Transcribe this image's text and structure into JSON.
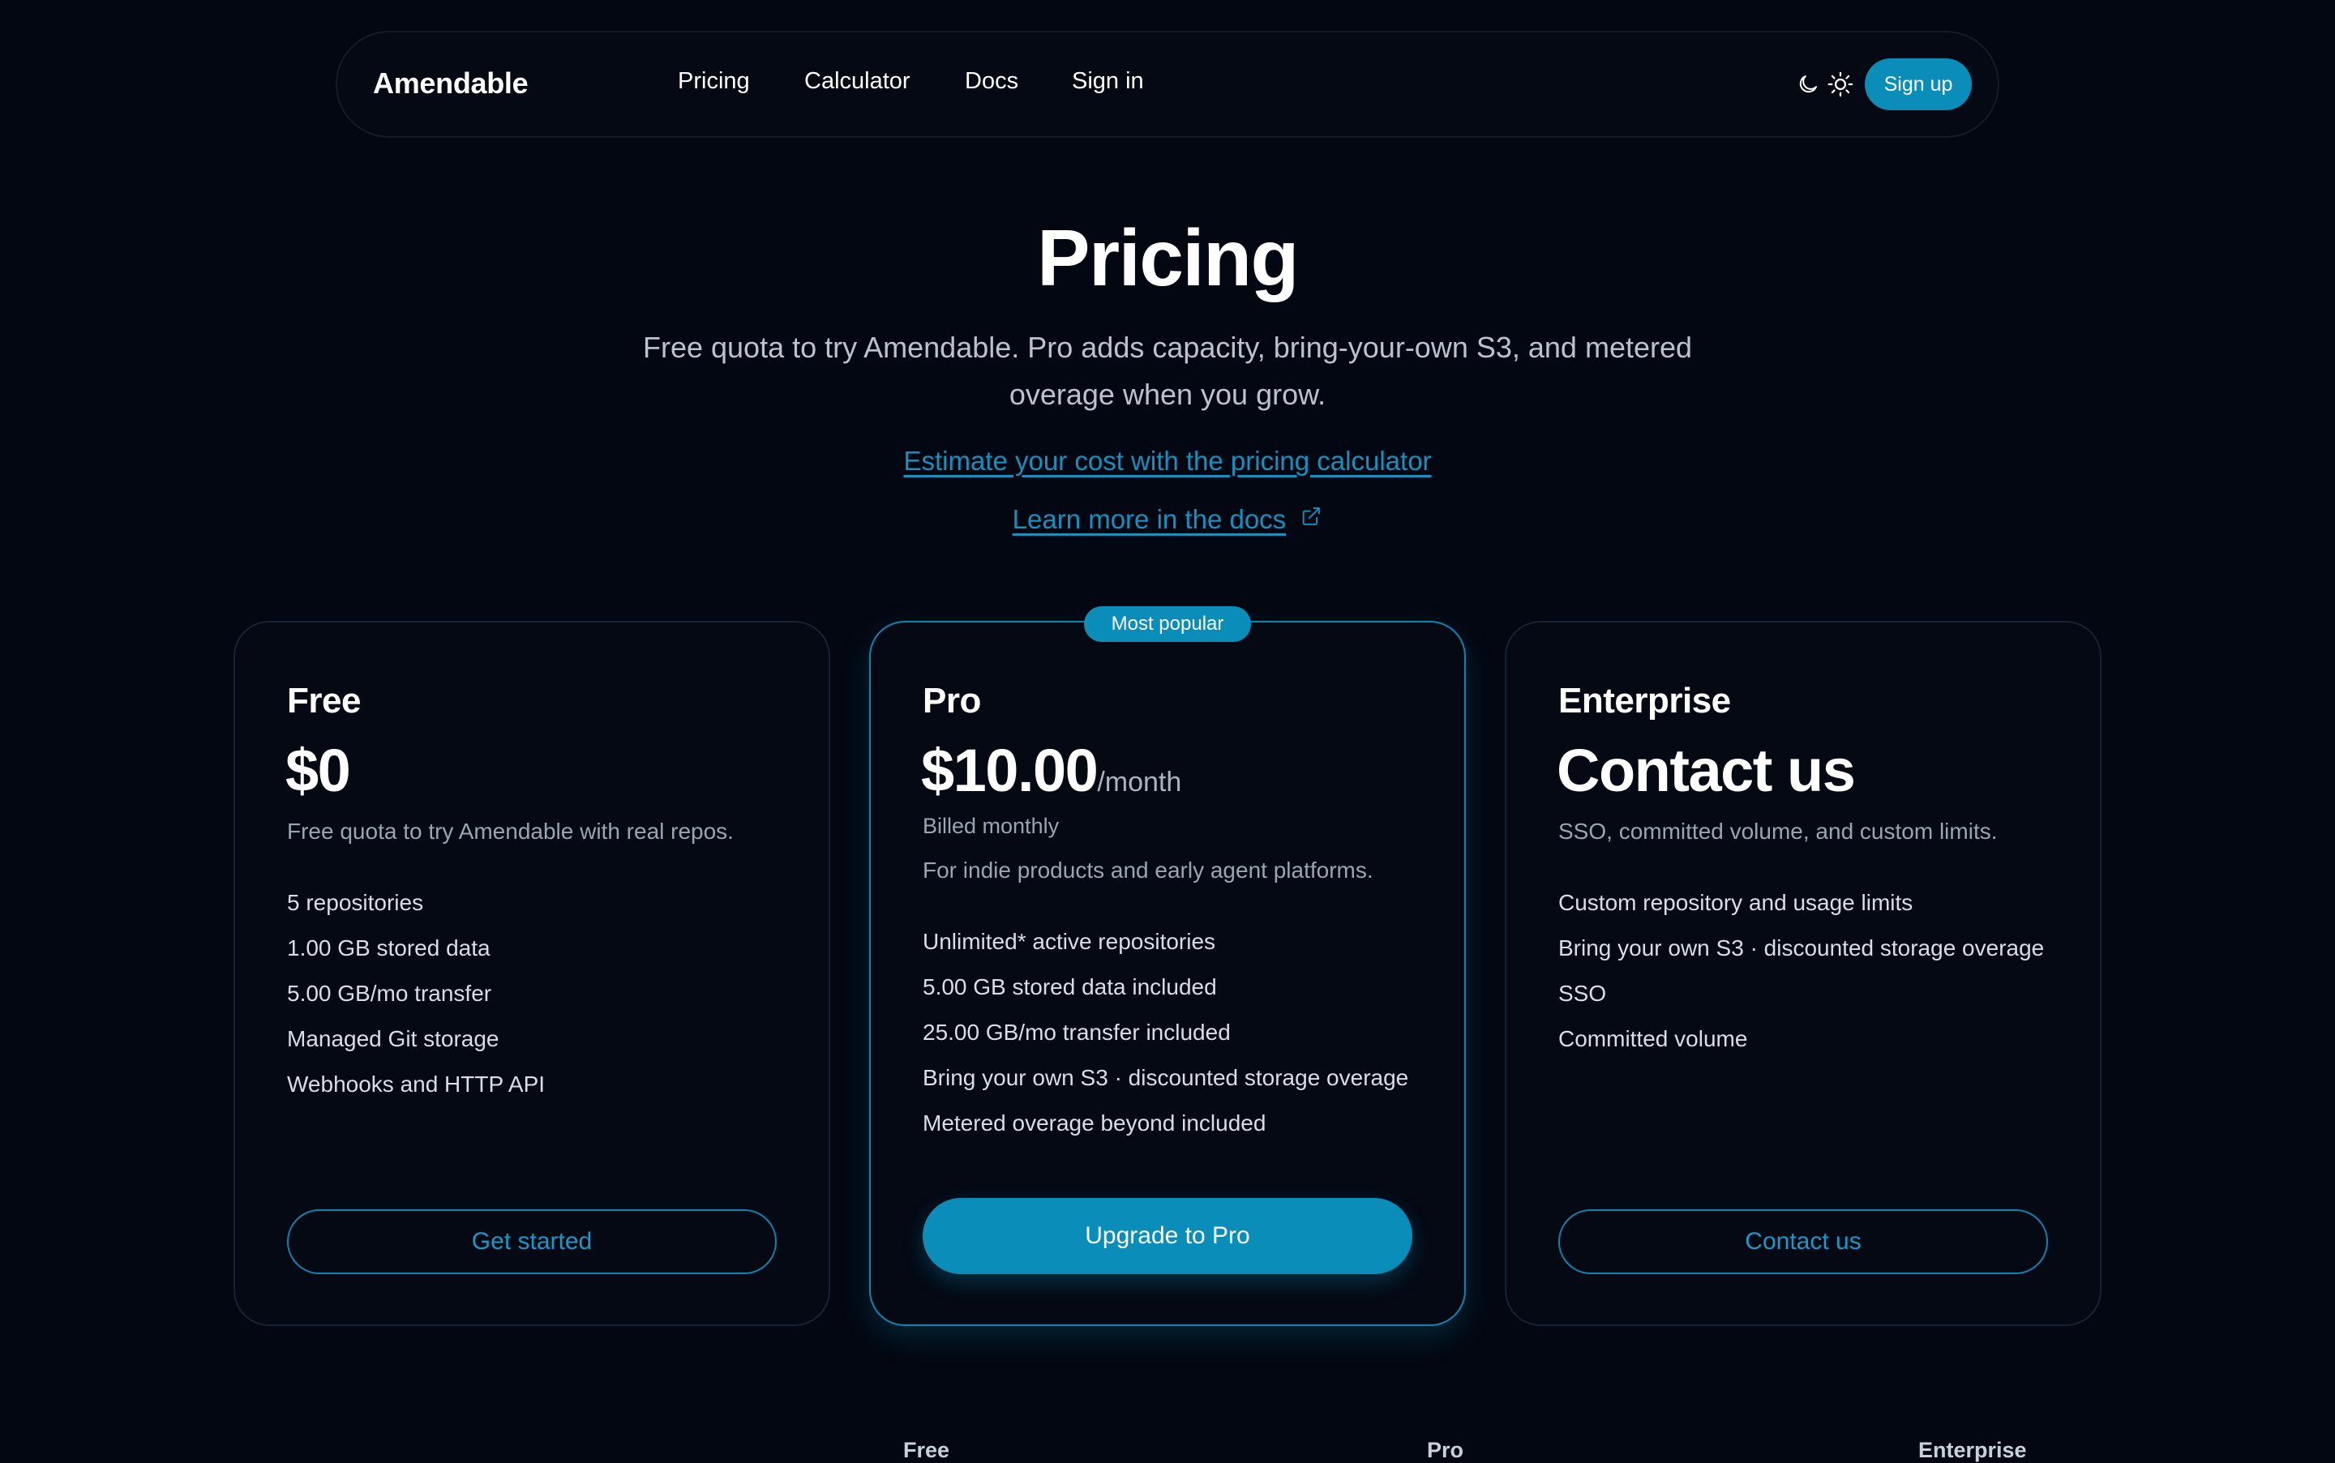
{
  "nav": {
    "brand": "Amendable",
    "links": [
      "Pricing",
      "Calculator",
      "Docs",
      "Sign in"
    ],
    "signup_label": "Sign up"
  },
  "hero": {
    "title": "Pricing",
    "subtitle": "Free quota to try Amendable. Pro adds capacity, bring-your-own S3, and metered overage when you grow.",
    "calculator_link": "Estimate your cost with the pricing calculator",
    "docs_link": "Learn more in the docs"
  },
  "plans": [
    {
      "name": "Free",
      "price": "$0",
      "description": "Free quota to try Amendable with real repos.",
      "features": [
        "5 repositories",
        "1.00 GB stored data",
        "5.00 GB/mo transfer",
        "Managed Git storage",
        "Webhooks and HTTP API"
      ],
      "cta": "Get started"
    },
    {
      "name": "Pro",
      "badge": "Most popular",
      "price": "$10.00",
      "period": "/month",
      "billing": "Billed monthly",
      "description": "For indie products and early agent platforms.",
      "features": [
        "Unlimited* active repositories",
        "5.00 GB stored data included",
        "25.00 GB/mo transfer included",
        "Bring your own S3 · discounted storage overage",
        "Metered overage beyond included"
      ],
      "cta": "Upgrade to Pro"
    },
    {
      "name": "Enterprise",
      "price": "Contact us",
      "description": "SSO, committed volume, and custom limits.",
      "features": [
        "Custom repository and usage limits",
        "Bring your own S3 · discounted storage overage",
        "SSO",
        "Committed volume"
      ],
      "cta": "Contact us"
    }
  ],
  "comparison_headers": [
    "Free",
    "Pro",
    "Enterprise"
  ],
  "colors": {
    "background": "#030711",
    "accent": "#0a8db8",
    "link": "#1690bc",
    "card_border": "#182232"
  },
  "icons": {
    "theme_dark": "moon-icon",
    "theme_light": "sun-icon",
    "external_link": "external-link-icon"
  }
}
